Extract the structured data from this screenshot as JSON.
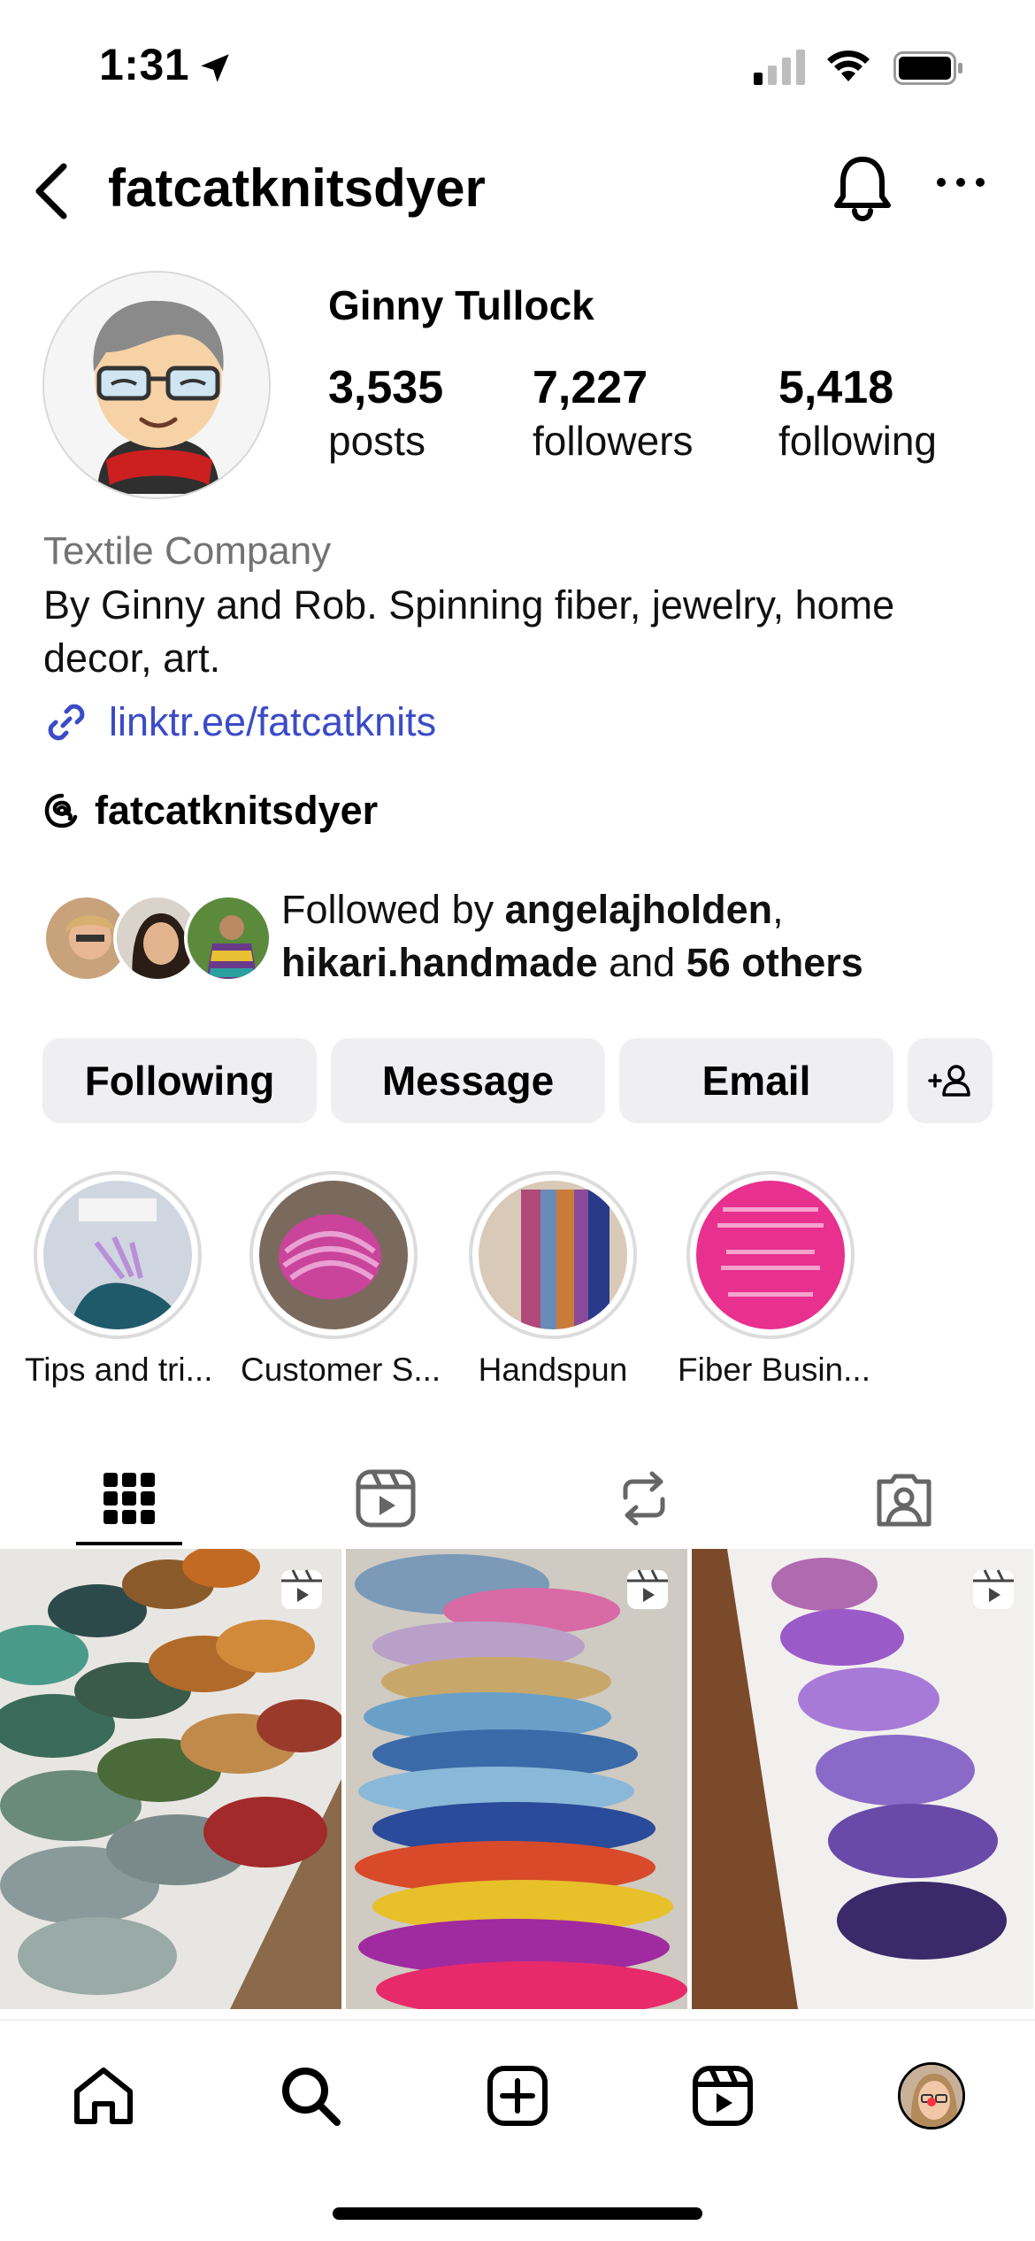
{
  "status_bar": {
    "time": "1:31"
  },
  "header": {
    "username": "fatcatknitsdyer",
    "icons": [
      "back-icon",
      "bell-icon",
      "more-icon"
    ]
  },
  "profile": {
    "display_name": "Ginny Tullock",
    "stats": {
      "posts": {
        "value": "3,535",
        "label": "posts"
      },
      "followers": {
        "value": "7,227",
        "label": "followers"
      },
      "following": {
        "value": "5,418",
        "label": "following"
      }
    },
    "category": "Textile Company",
    "bio": "By Ginny and Rob. Spinning fiber, jewelry, home decor, art.",
    "link": "linktr.ee/fatcatknits",
    "threads_handle": "fatcatknitsdyer",
    "followed_by": {
      "prefix": "Followed by ",
      "user1": "angelajholden",
      "sep": ",",
      "user2": "hikari.handmade",
      "middle": " and ",
      "others": "56 others"
    }
  },
  "actions": {
    "following": "Following",
    "message": "Message",
    "email": "Email"
  },
  "highlights": [
    {
      "label": "Tips and tri..."
    },
    {
      "label": "Customer S..."
    },
    {
      "label": "Handspun"
    },
    {
      "label": "Fiber Busin..."
    }
  ],
  "tabs": [
    "grid-icon",
    "reels-icon",
    "reposts-icon",
    "tagged-icon"
  ],
  "nav": [
    "home-icon",
    "search-icon",
    "create-icon",
    "reels-icon",
    "profile-avatar"
  ],
  "colors": {
    "link": "#3b4bc8",
    "muted": "#737373",
    "button_bg": "#efeff1",
    "notification": "#ff3040"
  }
}
